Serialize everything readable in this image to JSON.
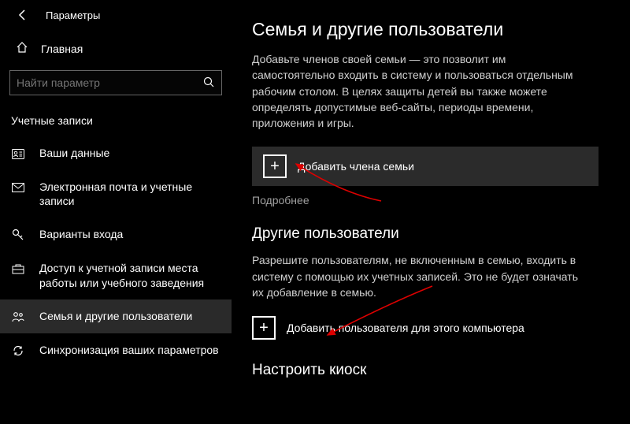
{
  "window_title": "Параметры",
  "home_label": "Главная",
  "search": {
    "placeholder": "Найти параметр"
  },
  "section": "Учетные записи",
  "nav": [
    {
      "label": "Ваши данные"
    },
    {
      "label": "Электронная почта и учетные записи"
    },
    {
      "label": "Варианты входа"
    },
    {
      "label": "Доступ к учетной записи места работы или учебного заведения"
    },
    {
      "label": "Семья и другие пользователи"
    },
    {
      "label": "Синхронизация ваших параметров"
    }
  ],
  "main": {
    "title": "Семья и другие пользователи",
    "family_desc": "Добавьте членов своей семьи — это позволит им самостоятельно входить в систему и пользоваться отдельным рабочим столом. В целях защиты детей вы также можете определять допустимые веб-сайты, периоды времени, приложения и игры.",
    "add_family": "Добавить члена семьи",
    "more": "Подробнее",
    "other_title": "Другие пользователи",
    "other_desc": "Разрешите пользователям, не включенным в семью, входить в систему с помощью их учетных записей. Это не будет означать их добавление в семью.",
    "add_other": "Добавить пользователя для этого компьютера",
    "kiosk": "Настроить киоск"
  }
}
